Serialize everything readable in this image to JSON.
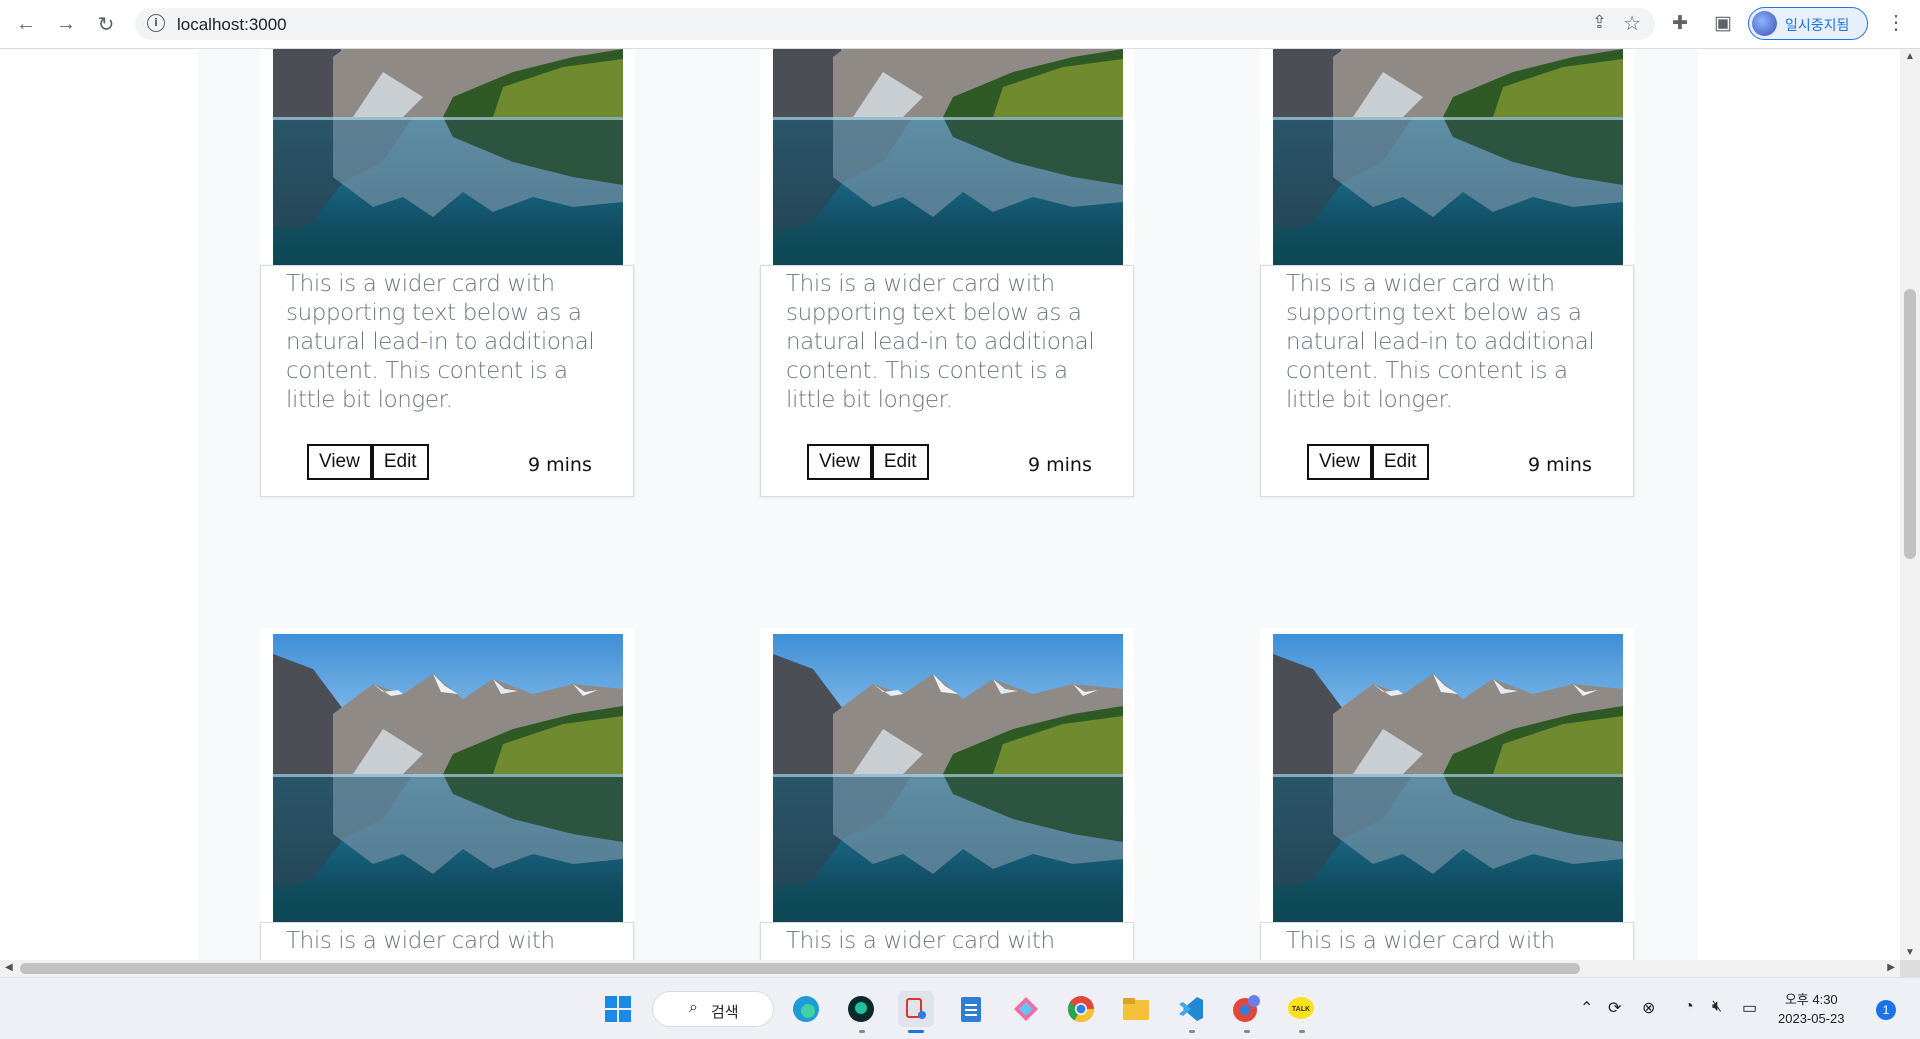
{
  "browser": {
    "url": "localhost:3000",
    "profile_label": "일시중지됨"
  },
  "cards": [
    {
      "text": "This is a wider card with supporting text below as a natural lead-in to additional content. This content is a little bit longer.",
      "view_label": "View",
      "edit_label": "Edit",
      "time": "9 mins"
    },
    {
      "text": "This is a wider card with supporting text below as a natural lead-in to additional content. This content is a little bit longer.",
      "view_label": "View",
      "edit_label": "Edit",
      "time": "9 mins"
    },
    {
      "text": "This is a wider card with supporting text below as a natural lead-in to additional content. This content is a little bit longer.",
      "view_label": "View",
      "edit_label": "Edit",
      "time": "9 mins"
    },
    {
      "text": "This is a wider card with"
    },
    {
      "text": "This is a wider card with"
    },
    {
      "text": "This is a wider card with"
    }
  ],
  "taskbar": {
    "search_label": "검색",
    "time": "오후 4:30",
    "date": "2023-05-23",
    "notification_count": "1"
  }
}
